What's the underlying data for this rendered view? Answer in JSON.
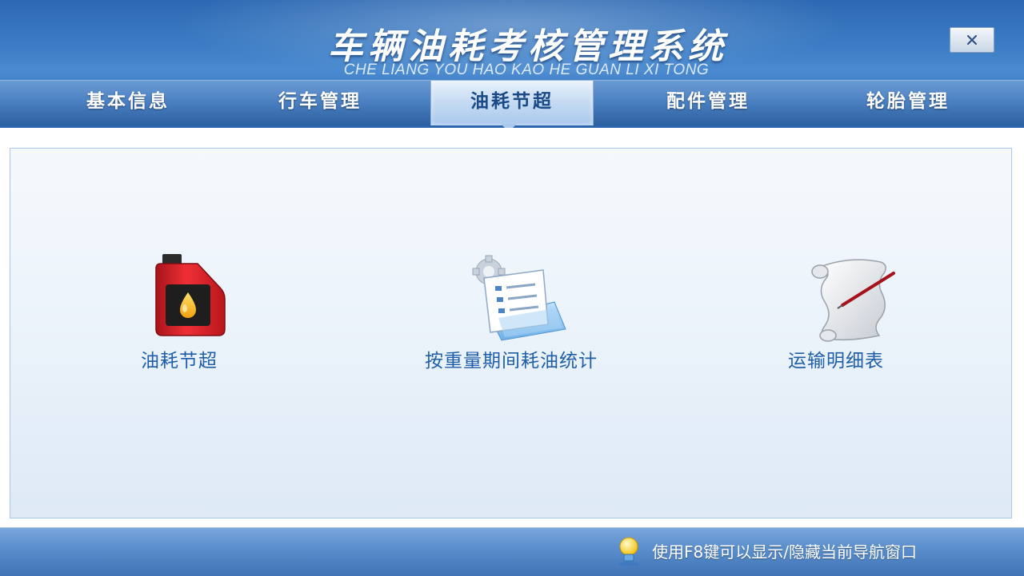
{
  "window": {
    "title": "车辆油耗考核管理系统",
    "subtitle": "CHE LIANG YOU HAO KAO HE  GUAN  LI XI TONG",
    "close_label": "×"
  },
  "nav": {
    "tabs": [
      {
        "label": "基本信息",
        "active": false
      },
      {
        "label": "行车管理",
        "active": false
      },
      {
        "label": "油耗节超",
        "active": true
      },
      {
        "label": "配件管理",
        "active": false
      },
      {
        "label": "轮胎管理",
        "active": false
      }
    ]
  },
  "main": {
    "items": [
      {
        "label": "油耗节超",
        "icon": "oil-can-icon"
      },
      {
        "label": "按重量期间耗油统计",
        "icon": "report-settings-icon"
      },
      {
        "label": "运输明细表",
        "icon": "scroll-pen-icon"
      }
    ]
  },
  "status": {
    "hint": "使用F8键可以显示/隐藏当前导航窗口",
    "icon": "lightbulb-icon"
  },
  "colors": {
    "header_blue": "#2d69b3",
    "tab_active": "#c7dcf3",
    "label_blue": "#1f5ea8",
    "oil_red": "#e0262b"
  }
}
